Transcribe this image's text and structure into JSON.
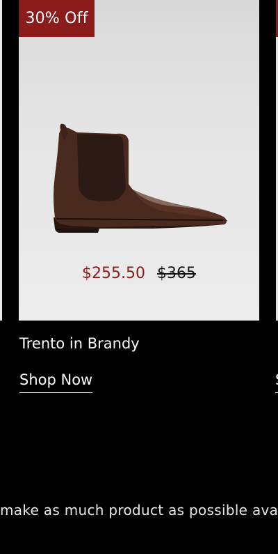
{
  "product": {
    "badge": "30% Off",
    "name": "Trento in Brandy",
    "price_sale": "$255.50",
    "price_original": "$365",
    "cta": "Shop Now",
    "image_alt": "boot"
  },
  "next_product": {
    "cta_fragment": "S"
  },
  "ticker": {
    "text": "make as much product as possible ava"
  },
  "colors": {
    "background": "#000000",
    "badge": "#8c1c1c",
    "sale_price": "#8c1c1c",
    "boot": "#4a2a1f"
  }
}
